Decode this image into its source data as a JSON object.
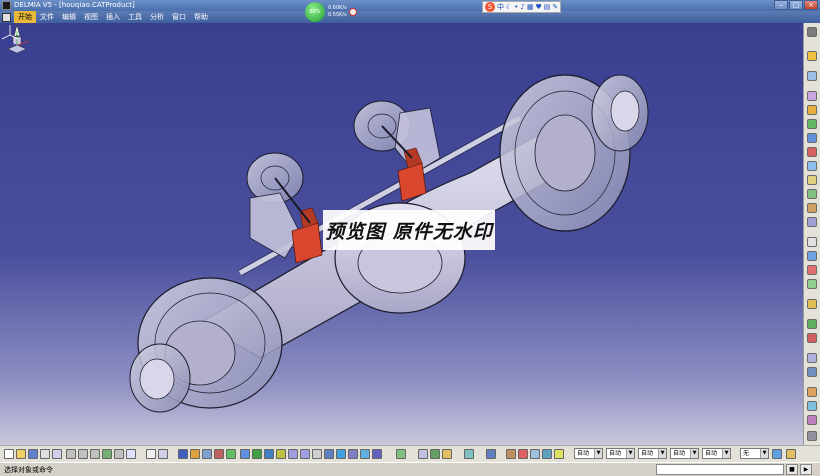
{
  "window": {
    "title": "DELMIA V5 - [houqiao.CATProduct]",
    "controls": [
      "–",
      "□",
      "×"
    ]
  },
  "menu": [
    "开始",
    "文件",
    "编辑",
    "视图",
    "插入",
    "工具",
    "分析",
    "窗口",
    "帮助"
  ],
  "netmon": {
    "percent": "88%",
    "up": "0.60K/s",
    "down": "0.55K/s"
  },
  "ime": {
    "logo": "S",
    "lang": "中"
  },
  "watermark": "预览图 原件无水印",
  "bottom_toolbar": {
    "combos": [
      {
        "value": "自动"
      },
      {
        "value": "自动"
      },
      {
        "value": "自动"
      },
      {
        "value": "自动"
      },
      {
        "value": "自动"
      },
      {
        "value": "无"
      }
    ]
  },
  "status": {
    "message": "选择对象或命令",
    "command_input": ""
  },
  "colors": {
    "background_top": "#393e8f",
    "background_bottom": "#c9c8dc",
    "mount_red": "#d9472f",
    "axle_outline": "#1a1a2a"
  }
}
